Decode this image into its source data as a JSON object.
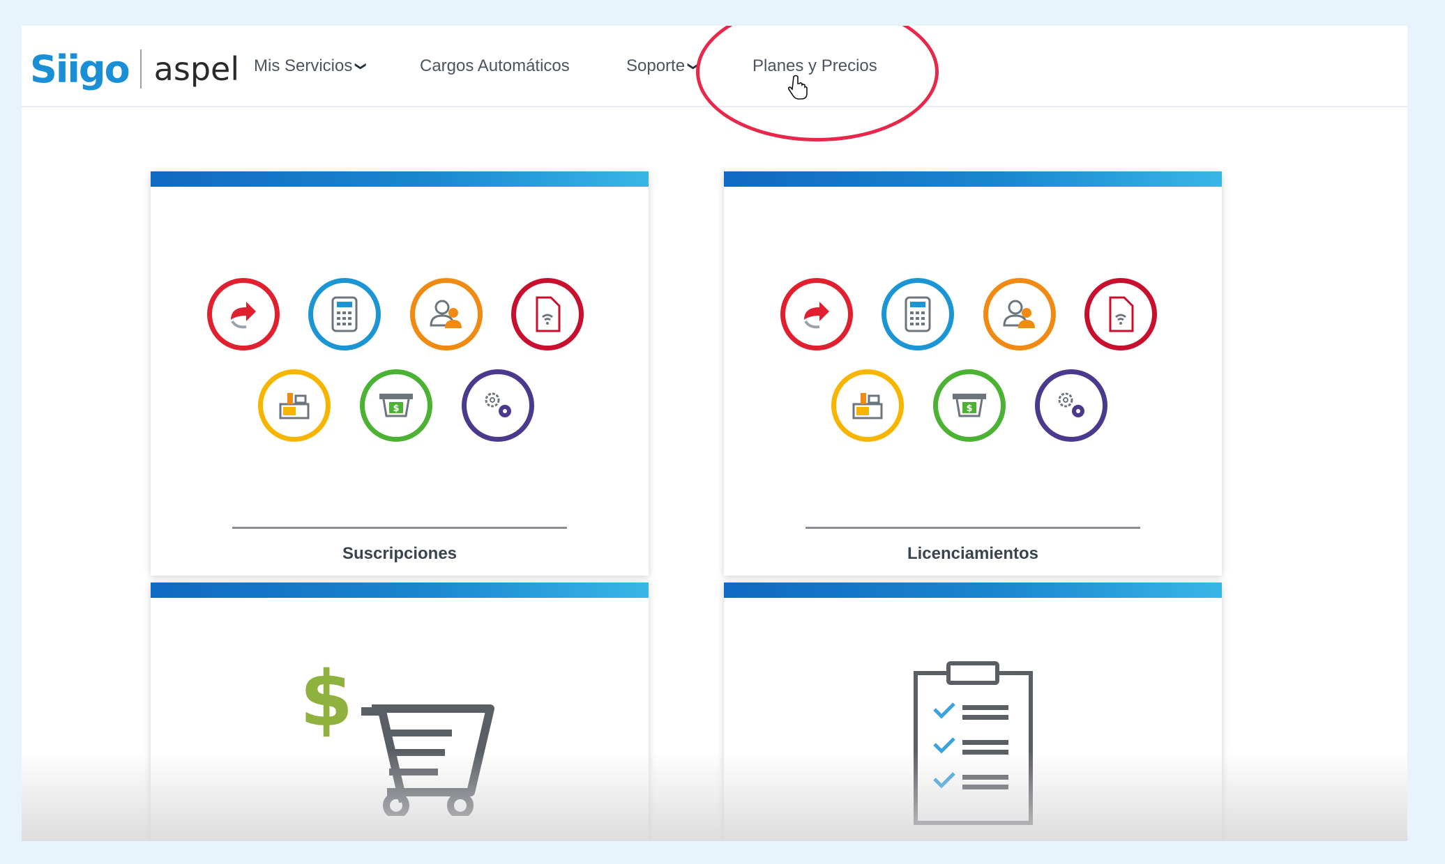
{
  "brand": {
    "logo_primary": "Siigo",
    "logo_secondary": "aspel"
  },
  "nav": {
    "items": [
      {
        "label": "Mis Servicios",
        "dropdown": true
      },
      {
        "label": "Cargos Automáticos",
        "dropdown": false
      },
      {
        "label": "Soporte",
        "dropdown": true
      },
      {
        "label": "Planes y Precios",
        "dropdown": false
      }
    ]
  },
  "cards": [
    {
      "label": "Suscripciones"
    },
    {
      "label": "Licenciamientos"
    }
  ],
  "colors": {
    "accent_blue": "#1a86cf",
    "highlight_red": "#e8284a",
    "icon_red": "#e0202e",
    "icon_blue": "#1b95d3",
    "icon_orange": "#f08a12",
    "icon_darkred": "#c8102e",
    "icon_yellow": "#f7b500",
    "icon_green": "#4cb233",
    "icon_purple": "#4b3a8c"
  }
}
